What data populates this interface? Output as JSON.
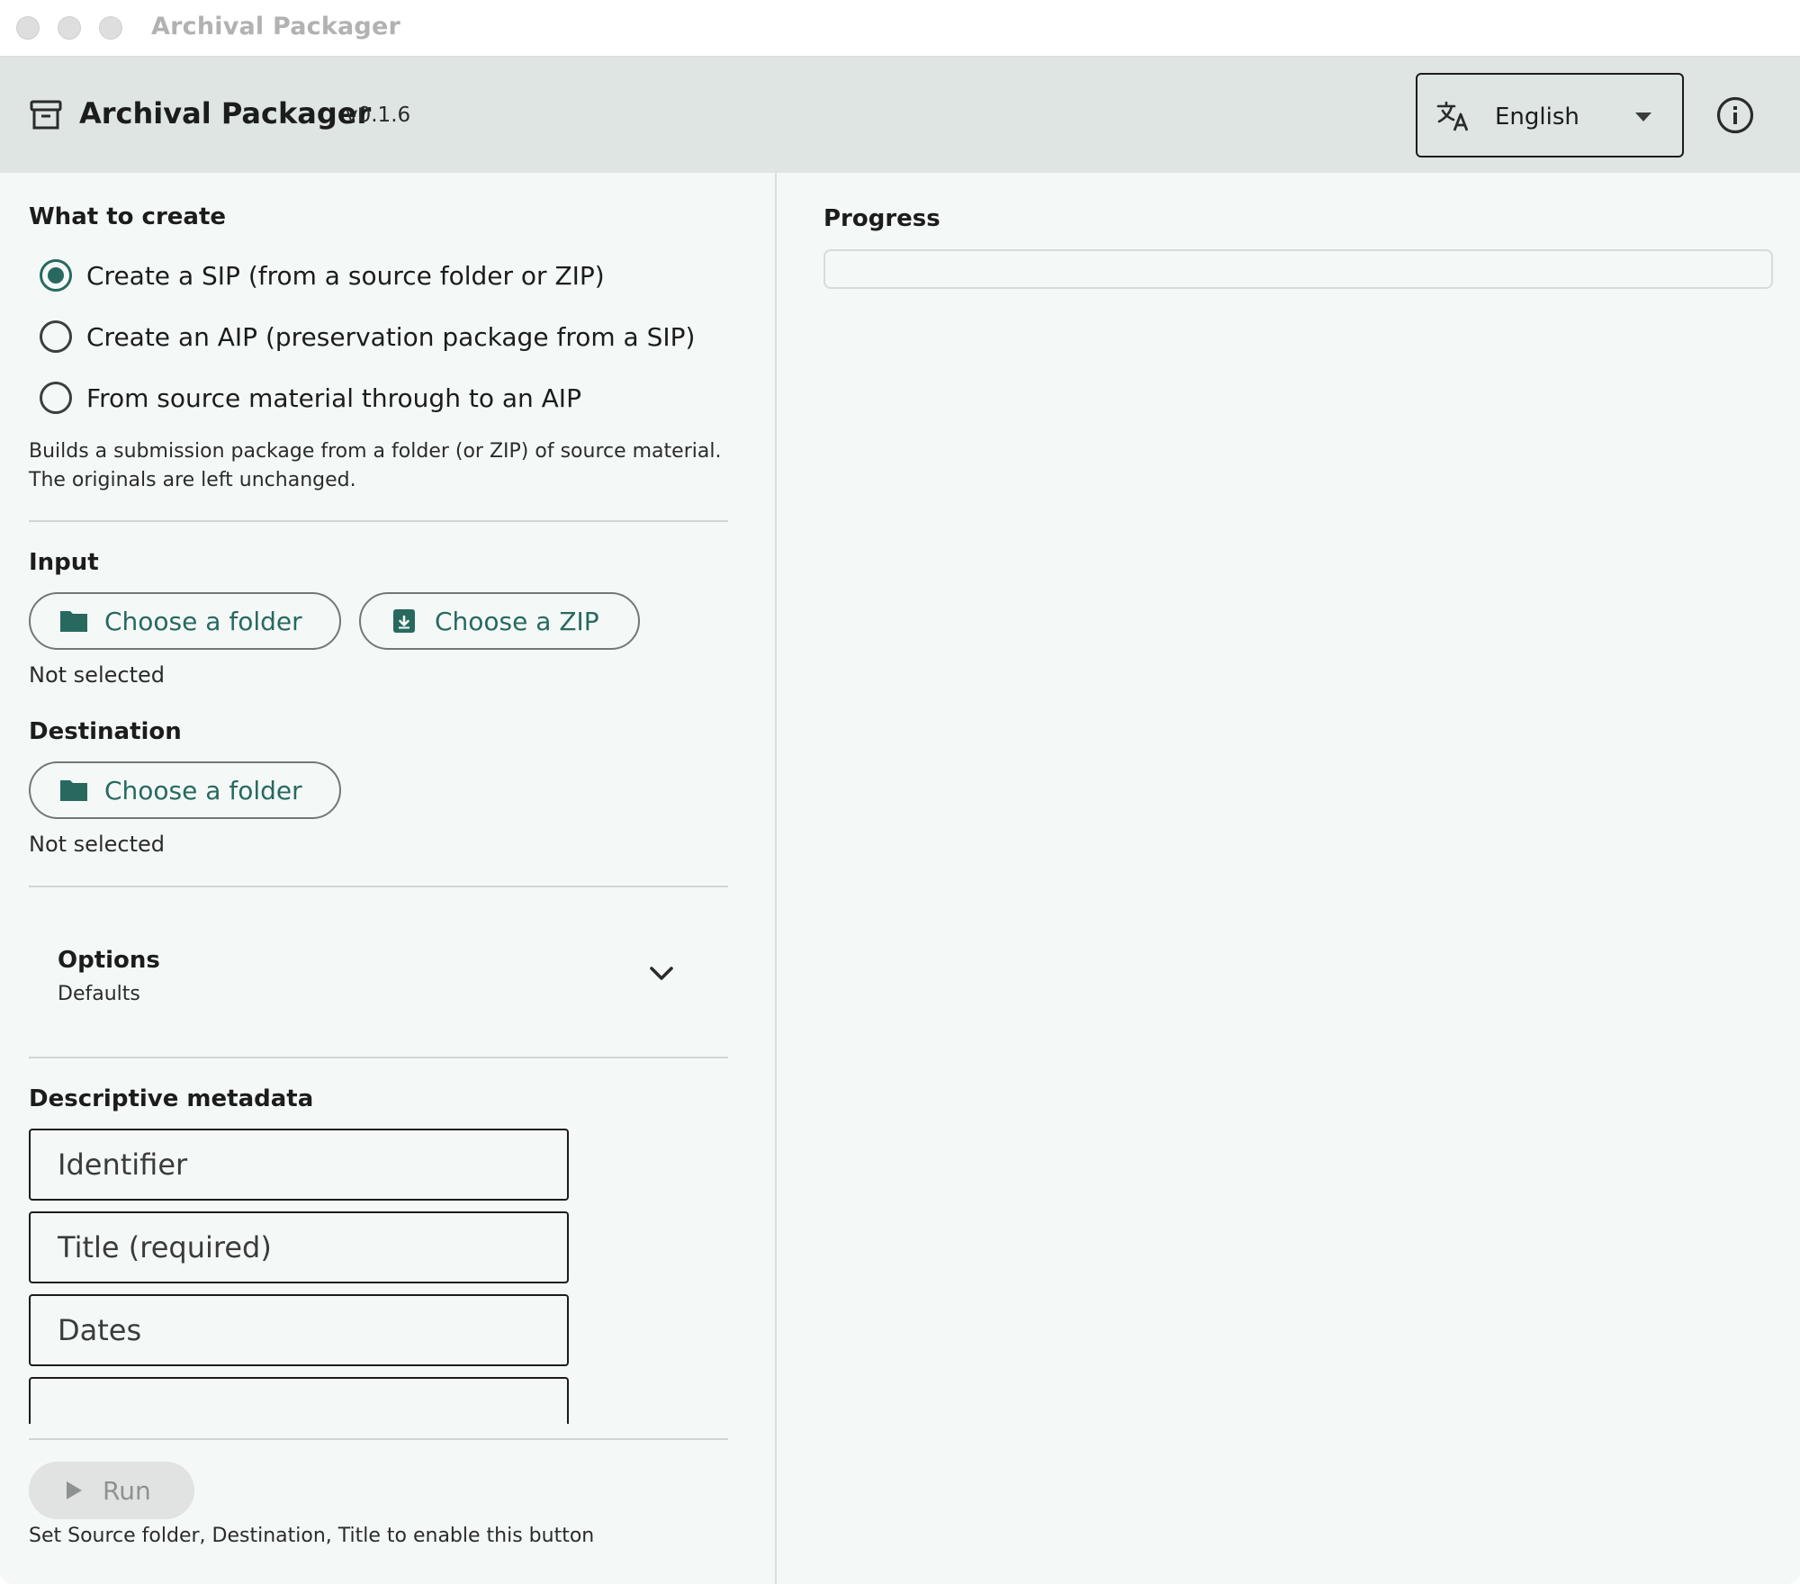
{
  "window": {
    "title": "Archival Packager"
  },
  "header": {
    "app_name": "Archival Packager",
    "version": "v0.1.6",
    "language": {
      "selected": "English"
    }
  },
  "what_to_create": {
    "heading": "What to create",
    "options": [
      {
        "label": "Create a SIP (from a source folder or ZIP)",
        "checked": true
      },
      {
        "label": "Create an AIP (preservation package from a SIP)",
        "checked": false
      },
      {
        "label": "From source material through to an AIP",
        "checked": false
      }
    ],
    "help_line_1": "Builds a submission package from a folder (or ZIP) of source material.",
    "help_line_2": "The originals are left unchanged."
  },
  "input": {
    "heading": "Input",
    "choose_folder_label": "Choose a folder",
    "choose_zip_label": "Choose a ZIP",
    "status": "Not selected"
  },
  "destination": {
    "heading": "Destination",
    "choose_folder_label": "Choose a folder",
    "status": "Not selected"
  },
  "options": {
    "title": "Options",
    "subtitle": "Defaults"
  },
  "metadata": {
    "heading": "Descriptive metadata",
    "fields": [
      {
        "placeholder": "Identifier",
        "value": ""
      },
      {
        "placeholder": "Title (required)",
        "value": ""
      },
      {
        "placeholder": "Dates",
        "value": ""
      },
      {
        "placeholder": "",
        "value": ""
      }
    ]
  },
  "run": {
    "label": "Run",
    "hint": "Set Source folder, Destination, Title to enable this button"
  },
  "progress": {
    "heading": "Progress",
    "fraction": 0
  },
  "colors": {
    "accent": "#27695f",
    "header_bg": "#dfe5e2",
    "panel_bg": "#f4f9f7"
  }
}
